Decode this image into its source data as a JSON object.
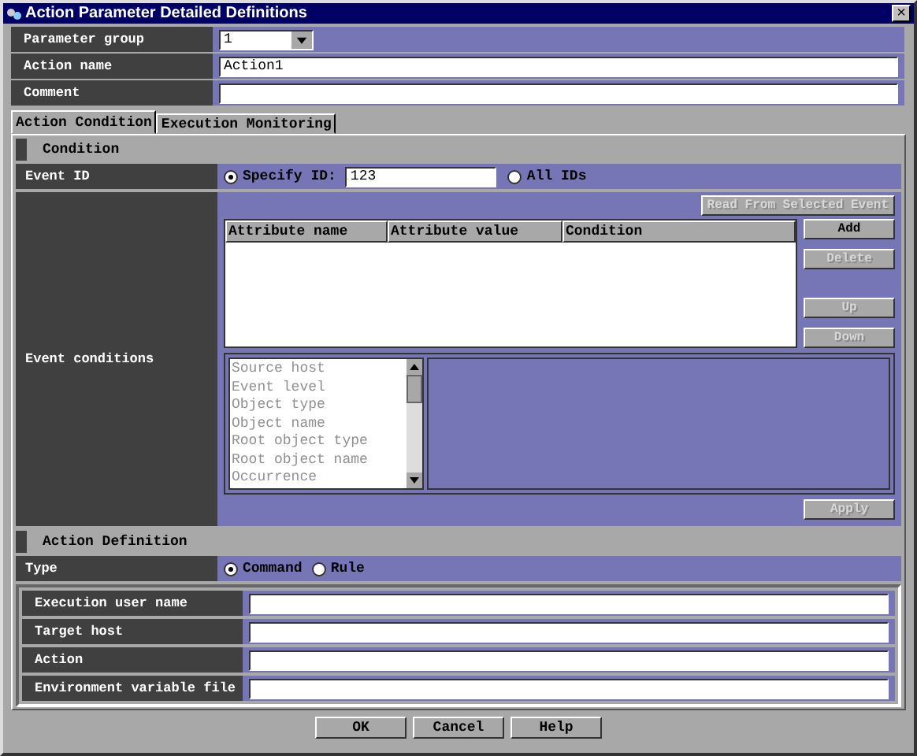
{
  "window": {
    "title": "Action Parameter Detailed Definitions",
    "close": "×"
  },
  "top_fields": [
    {
      "kind": "dropdown",
      "label": "Parameter group",
      "value": "1"
    },
    {
      "kind": "text",
      "label": "Action name",
      "value": "Action1"
    },
    {
      "kind": "text",
      "label": "Comment"
    }
  ],
  "tabs": [
    {
      "label": "Action Condition",
      "selected": true
    },
    {
      "label": "Execution Monitoring",
      "selected": false
    }
  ],
  "condition": {
    "heading": "Condition",
    "event_id": {
      "label": "Event ID",
      "options": [
        {
          "label": "Specify ID:",
          "selected": true
        },
        {
          "label": "All IDs",
          "selected": false
        }
      ],
      "value": "123"
    },
    "event_conditions": {
      "label": "Event conditions",
      "read_button": {
        "label": "Read From Selected Event",
        "disabled": true
      },
      "columns": [
        "Attribute name",
        "Attribute value",
        "Condition"
      ],
      "side_buttons": [
        {
          "label": "Add",
          "disabled": false
        },
        {
          "label": "Delete",
          "disabled": true
        },
        {
          "label": "Up",
          "disabled": true
        },
        {
          "label": "Down",
          "disabled": true
        }
      ],
      "attributes": [
        {
          "label": "Source host",
          "disabled": true
        },
        {
          "label": "Event level",
          "disabled": true
        },
        {
          "label": "Object type",
          "disabled": true
        },
        {
          "label": "Object name",
          "disabled": true
        },
        {
          "label": "Root object type",
          "disabled": true
        },
        {
          "label": "Root object name",
          "disabled": true
        },
        {
          "label": "Occurrence",
          "disabled": true
        }
      ],
      "apply_button": {
        "label": "Apply",
        "disabled": true
      }
    }
  },
  "action_definition": {
    "heading": "Action Definition",
    "type": {
      "label": "Type",
      "options": [
        {
          "label": "Command",
          "selected": true
        },
        {
          "label": "Rule",
          "selected": false
        }
      ]
    },
    "fields": [
      {
        "label": "Execution user name"
      },
      {
        "label": "Target host"
      },
      {
        "label": "Action"
      },
      {
        "label": "Environment variable file"
      }
    ]
  },
  "buttons": [
    {
      "label": "OK"
    },
    {
      "label": "Cancel"
    },
    {
      "label": "Help"
    }
  ]
}
